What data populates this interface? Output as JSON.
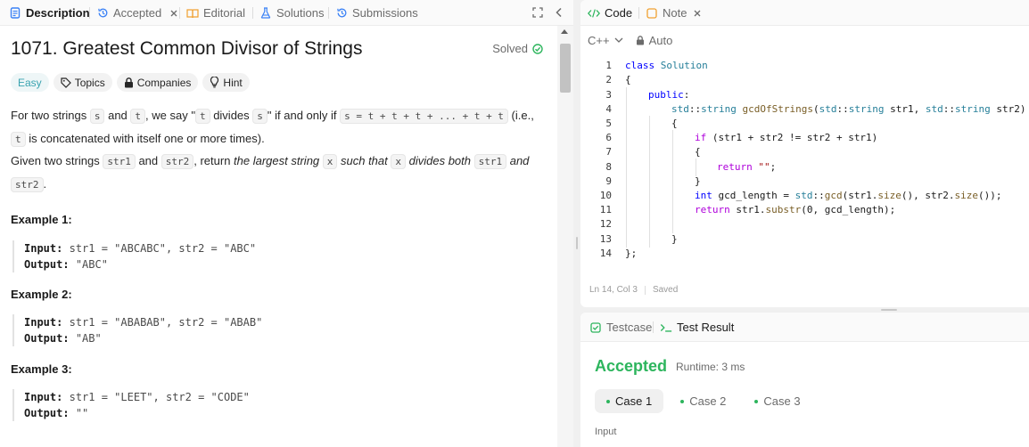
{
  "left_tabs": {
    "description": "Description",
    "accepted": "Accepted",
    "editorial": "Editorial",
    "solutions": "Solutions",
    "submissions": "Submissions"
  },
  "problem": {
    "title": "1071. Greatest Common Divisor of Strings",
    "solved_label": "Solved",
    "difficulty": "Easy",
    "chips": {
      "topics": "Topics",
      "companies": "Companies",
      "hint": "Hint"
    },
    "p1": {
      "t1": "For two strings ",
      "c1": "s",
      "t2": " and ",
      "c2": "t",
      "t3": ", we say \"",
      "c3": "t",
      "t4": " divides ",
      "c4": "s",
      "t5": "\" if and only if ",
      "c5": "s = t + t + t + ... + t + t",
      "t6": " (i.e., ",
      "c6": "t",
      "t7": " is concatenated with itself one or more times)."
    },
    "p2": {
      "t1": "Given two strings ",
      "c1": "str1",
      "t2": " and ",
      "c2": "str2",
      "t3": ", return ",
      "i1": "the largest string ",
      "c3": "x",
      "i2": " such that ",
      "c4": "x",
      "i3": " divides both ",
      "c5": "str1",
      "i4": " and ",
      "c6": "str2",
      "t4": "."
    },
    "examples": [
      {
        "heading": "Example 1:",
        "input_label": "Input:",
        "input": "str1 = \"ABCABC\", str2 = \"ABC\"",
        "output_label": "Output:",
        "output": "\"ABC\""
      },
      {
        "heading": "Example 2:",
        "input_label": "Input:",
        "input": "str1 = \"ABABAB\", str2 = \"ABAB\"",
        "output_label": "Output:",
        "output": "\"AB\""
      },
      {
        "heading": "Example 3:",
        "input_label": "Input:",
        "input": "str1 = \"LEET\", str2 = \"CODE\"",
        "output_label": "Output:",
        "output": "\"\""
      }
    ]
  },
  "code_tabs": {
    "code": "Code",
    "note": "Note"
  },
  "code_toolbar": {
    "language": "C++",
    "mode": "Auto"
  },
  "code": {
    "line_numbers": [
      "1",
      "2",
      "3",
      "4",
      "5",
      "6",
      "7",
      "8",
      "9",
      "10",
      "11",
      "12",
      "13",
      "14"
    ],
    "l1a": "class",
    "l1b": "Solution",
    "l2": "{",
    "l3a": "public",
    "l3b": ":",
    "l4a": "std",
    "l4b": "::",
    "l4c": "string",
    "l4d": "gcdOfStrings",
    "l4e": "(",
    "l4f": "std",
    "l4g": "::",
    "l4h": "string",
    "l4i": " str1, ",
    "l4j": "std",
    "l4k": "::",
    "l4l": "string",
    "l4m": " str2)",
    "l5": "{",
    "l6a": "if",
    "l6b": " (str1 + str2 != str2 + str1)",
    "l7": "{",
    "l8a": "return",
    "l8b": "\"\"",
    "l8c": ";",
    "l9": "}",
    "l10a": "int",
    "l10b": " gcd_length = ",
    "l10c": "std",
    "l10d": "::",
    "l10e": "gcd",
    "l10f": "(str1.",
    "l10g": "size",
    "l10h": "(), str2.",
    "l10i": "size",
    "l10j": "());",
    "l11a": "return",
    "l11b": " str1.",
    "l11c": "substr",
    "l11d": "(0, gcd_length);",
    "l13": "}",
    "l14": "};"
  },
  "status": {
    "position": "Ln 14, Col 3",
    "saved": "Saved"
  },
  "result_tabs": {
    "testcase": "Testcase",
    "test_result": "Test Result"
  },
  "result": {
    "verdict": "Accepted",
    "runtime": "Runtime: 3 ms",
    "cases": [
      "Case 1",
      "Case 2",
      "Case 3"
    ],
    "input_label": "Input"
  },
  "colors": {
    "accent_green": "#2db55d",
    "easy_teal": "#3aa3b0",
    "keyword_blue": "#0000ff"
  }
}
